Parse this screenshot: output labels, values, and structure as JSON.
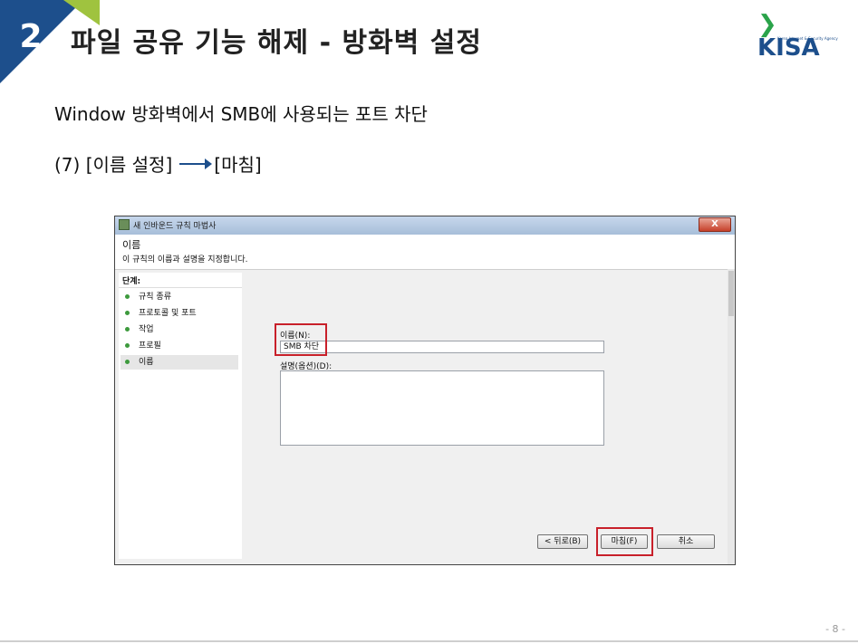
{
  "slide": {
    "section_number": "2",
    "title": "파일 공유 기능 해제 - 방화벽 설정",
    "logo_text": "KISA",
    "logo_subtext": "Korea Internet & Security Agency",
    "subtitle": "Window 방화벽에서 SMB에 사용되는 포트 차단",
    "step_label_before": "(7) [이름 설정]",
    "step_label_after": "[마침]",
    "page_number": "- 8 -",
    "accent_color": "#1d4f8c",
    "accent_green": "#9fc33f"
  },
  "dialog": {
    "title": "새 인바운드 규칙 마법사",
    "close_label": "X",
    "header_title": "이름",
    "header_description": "이 규칙의 이름과 설명을 지정합니다.",
    "steps_title": "단계:",
    "steps": [
      {
        "label": "규칙 종류"
      },
      {
        "label": "프로토콜 및 포트"
      },
      {
        "label": "작업"
      },
      {
        "label": "프로필"
      },
      {
        "label": "이름"
      }
    ],
    "active_step": "이름",
    "name_label": "이름(N):",
    "name_value": "SMB 차단",
    "description_label": "설명(옵션)(D):",
    "description_value": "",
    "buttons": {
      "back": "< 뒤로(B)",
      "finish": "마침(F)",
      "cancel": "취소"
    },
    "highlight_color": "#c8202a"
  }
}
